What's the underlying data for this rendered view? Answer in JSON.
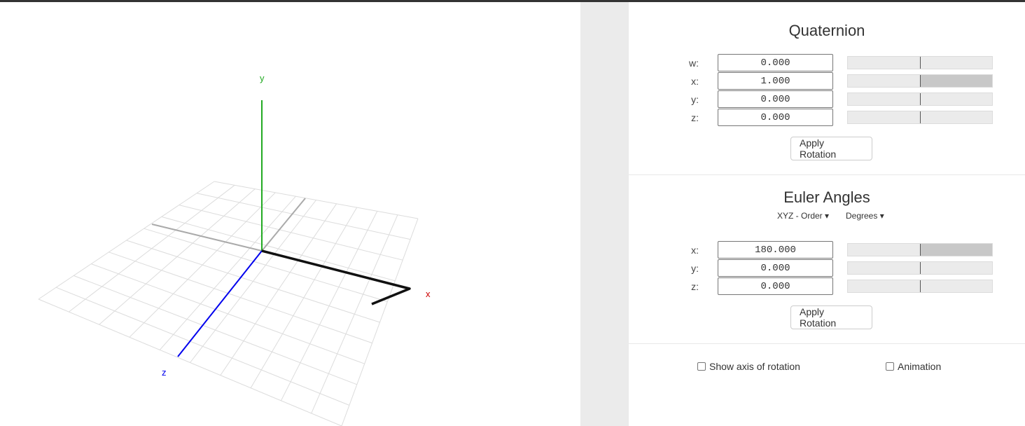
{
  "viewport": {
    "axes": {
      "x_label": "x",
      "y_label": "y",
      "z_label": "z"
    },
    "colors": {
      "x": "#cc0000",
      "y": "#22aa22",
      "z": "#0000ee",
      "object": "#111111"
    }
  },
  "quaternion": {
    "title": "Quaternion",
    "rows": [
      {
        "label": "w:",
        "value": "0.000",
        "level": 0.0
      },
      {
        "label": "x:",
        "value": "1.000",
        "level": 1.0
      },
      {
        "label": "y:",
        "value": "0.000",
        "level": 0.0
      },
      {
        "label": "z:",
        "value": "0.000",
        "level": 0.0
      }
    ],
    "apply_label": "Apply Rotation"
  },
  "euler": {
    "title": "Euler Angles",
    "order_select": "XYZ - Order ▾",
    "unit_select": "Degrees ▾",
    "rows": [
      {
        "label": "x:",
        "value": "180.000",
        "level": 1.0
      },
      {
        "label": "y:",
        "value": "0.000",
        "level": 0.0
      },
      {
        "label": "z:",
        "value": "0.000",
        "level": 0.0
      }
    ],
    "apply_label": "Apply Rotation"
  },
  "options": {
    "show_axis_label": "Show axis of rotation",
    "show_axis_checked": false,
    "animation_label": "Animation",
    "animation_checked": false
  }
}
